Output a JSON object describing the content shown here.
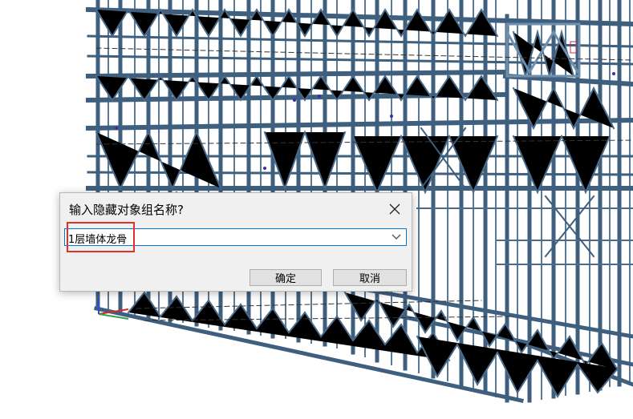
{
  "dialog": {
    "title": "输入隐藏对象组名称?",
    "combo_value": "1层墙体龙骨",
    "ok_label": "确定",
    "cancel_label": "取消"
  },
  "icons": {
    "close": "close-icon",
    "dropdown": "chevron-down-icon"
  },
  "colors": {
    "frame_steel": "#3e5f7e",
    "frame_light": "#6f8fad",
    "highlight_red": "#e0302a",
    "focus_blue": "#0078d7"
  }
}
